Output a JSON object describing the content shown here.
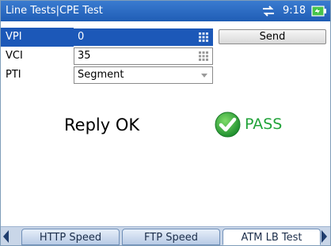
{
  "titlebar": {
    "title": "Line Tests|CPE Test",
    "time": "9:18",
    "network_icon": "network-arrows-icon",
    "battery_icon": "battery-icon"
  },
  "form": {
    "vpi": {
      "label": "VPI",
      "value": "0"
    },
    "vci": {
      "label": "VCI",
      "value": "35"
    },
    "pti": {
      "label": "PTI",
      "value": "Segment"
    }
  },
  "send_label": "Send",
  "result": {
    "reply": "Reply OK",
    "status": "PASS",
    "status_color": "#22a33a"
  },
  "tabs": [
    {
      "label": "HTTP Speed"
    },
    {
      "label": "FTP Speed"
    },
    {
      "label": "ATM LB Test"
    }
  ],
  "colors": {
    "titlebar": "#1f5db5",
    "selected_row": "#1c58b8"
  }
}
